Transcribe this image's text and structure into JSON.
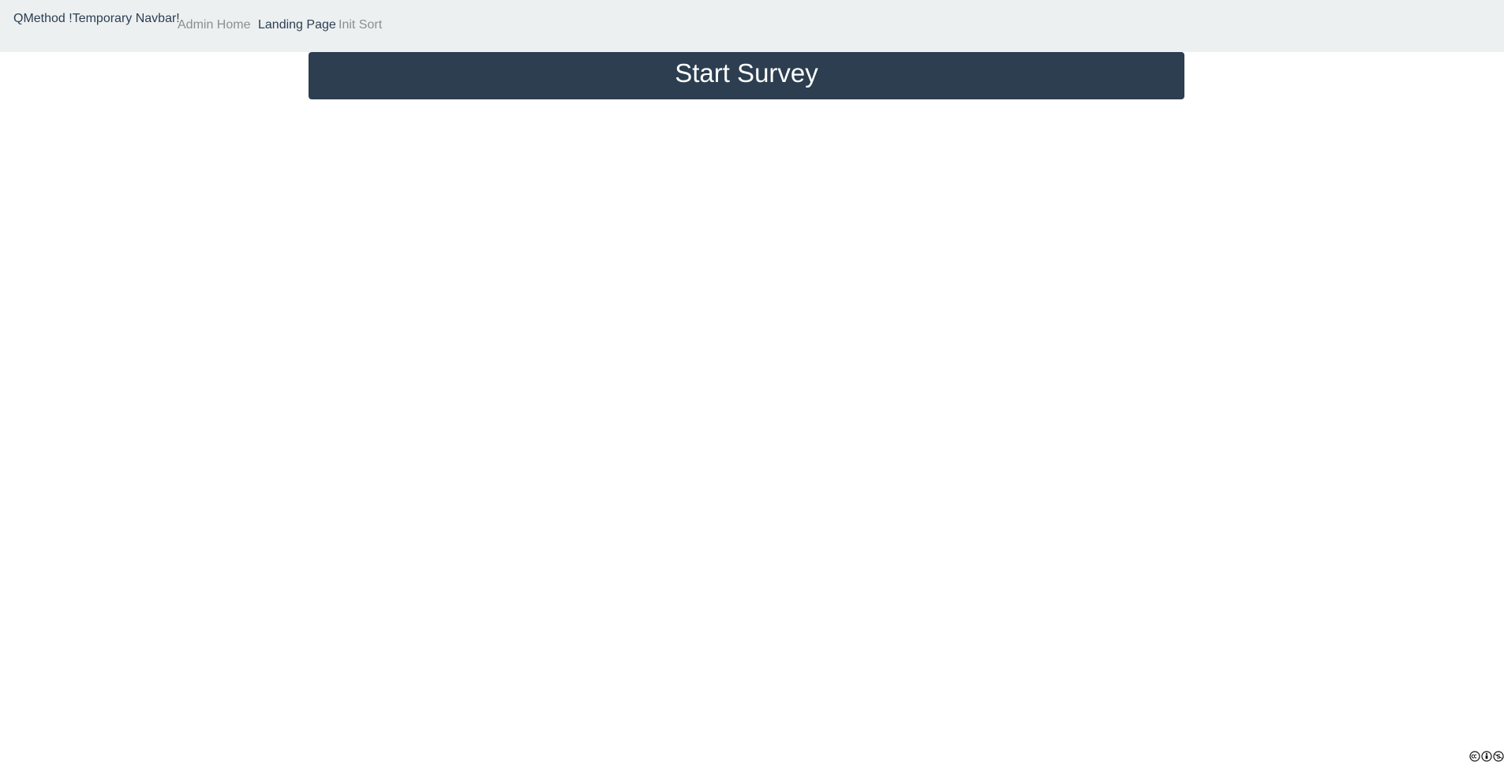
{
  "navbar": {
    "brand": "QMethod !Temporary Navbar!",
    "links": [
      {
        "label": "Admin Home",
        "state": "muted"
      },
      {
        "label": "Landing Page",
        "state": "active"
      },
      {
        "label": "Init Sort",
        "state": "muted"
      }
    ]
  },
  "main": {
    "start_button_label": "Start Survey"
  },
  "footer": {
    "license_icons": [
      "cc-icon",
      "by-icon",
      "nc-icon"
    ]
  },
  "colors": {
    "navbar_bg": "#ecf0f1",
    "primary": "#2c3e50",
    "muted_link": "#8a8f93"
  }
}
